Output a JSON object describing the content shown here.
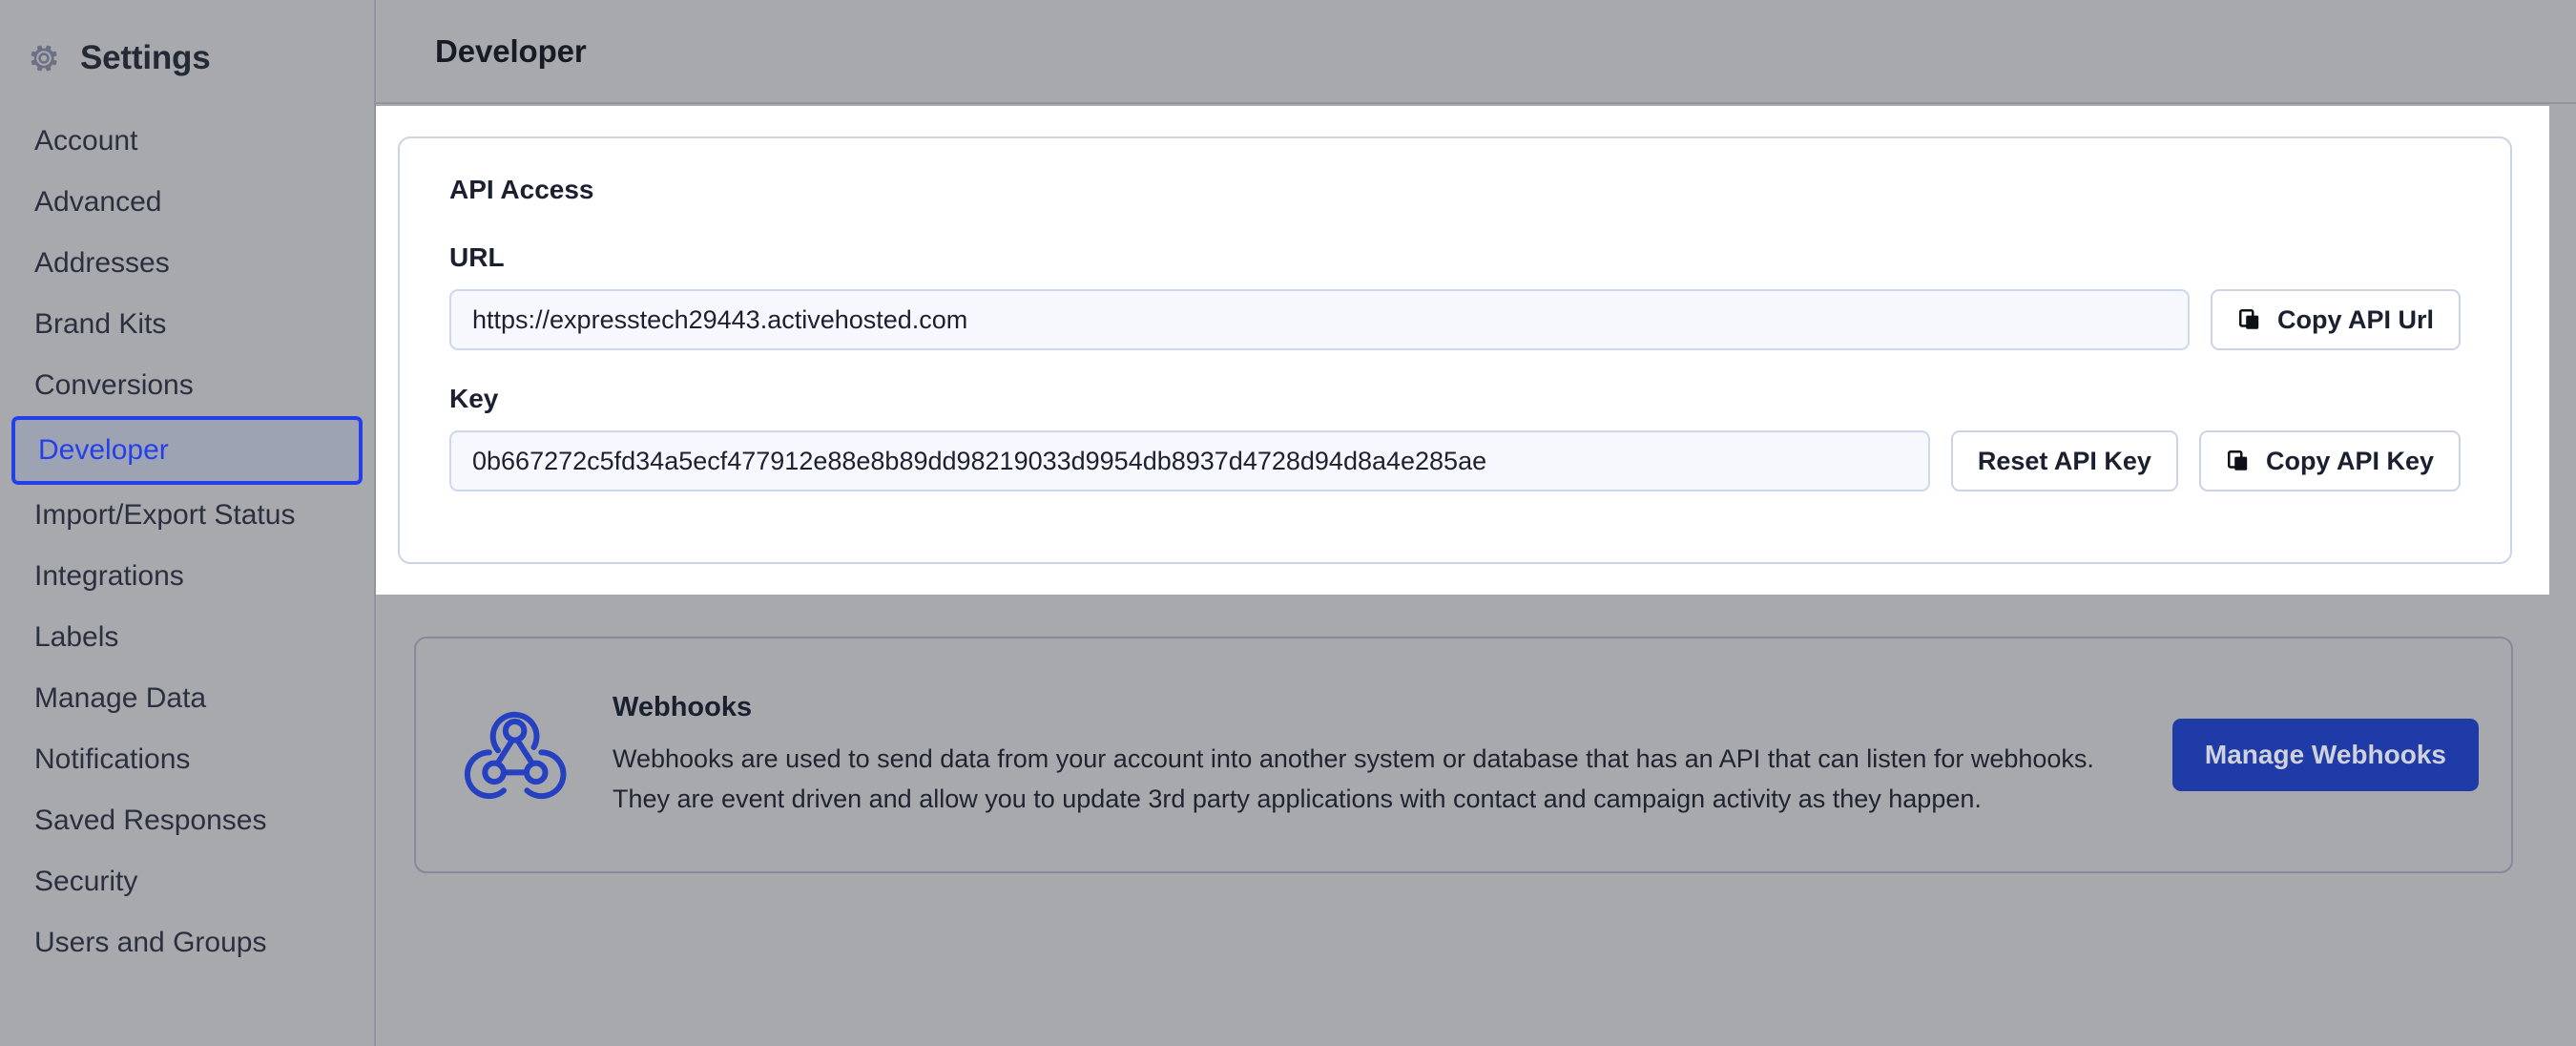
{
  "sidebar": {
    "title": "Settings",
    "gear_icon": "gear-icon",
    "items": [
      {
        "label": "Account",
        "selected": false
      },
      {
        "label": "Advanced",
        "selected": false
      },
      {
        "label": "Addresses",
        "selected": false
      },
      {
        "label": "Brand Kits",
        "selected": false
      },
      {
        "label": "Conversions",
        "selected": false
      },
      {
        "label": "Developer",
        "selected": true
      },
      {
        "label": "Import/Export Status",
        "selected": false
      },
      {
        "label": "Integrations",
        "selected": false
      },
      {
        "label": "Labels",
        "selected": false
      },
      {
        "label": "Manage Data",
        "selected": false
      },
      {
        "label": "Notifications",
        "selected": false
      },
      {
        "label": "Saved Responses",
        "selected": false
      },
      {
        "label": "Security",
        "selected": false
      },
      {
        "label": "Users and Groups",
        "selected": false
      }
    ]
  },
  "header": {
    "title": "Developer"
  },
  "api_access": {
    "heading": "API Access",
    "url_label": "URL",
    "url_value": "https://expresstech29443.activehosted.com",
    "copy_url_label": "Copy API Url",
    "key_label": "Key",
    "key_value": "0b667272c5fd34a5ecf477912e88e8b89dd98219033d9954db8937d4728d94d8a4e285ae",
    "reset_key_label": "Reset API Key",
    "copy_key_label": "Copy API Key",
    "copy_icon": "copy-icon"
  },
  "webhooks": {
    "icon": "webhook-icon",
    "title": "Webhooks",
    "description": "Webhooks are used to send data from your account into another system or database that has an API that can listen for webhooks. They are event driven and allow you to update 3rd party applications with contact and campaign activity as they happen.",
    "manage_label": "Manage Webhooks"
  },
  "colors": {
    "page_background": "#a8a9ad",
    "accent_blue": "#2540e8",
    "primary_button": "#1f3ba8",
    "webhook_icon": "#2540c0",
    "card_white": "#ffffff",
    "input_background": "#f7f8fd",
    "text_dark": "#1f2430"
  }
}
